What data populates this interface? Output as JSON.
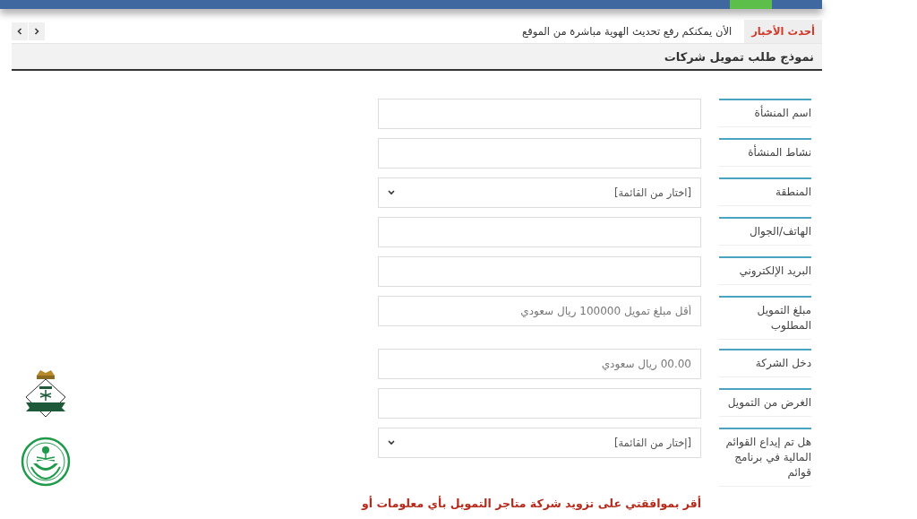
{
  "news": {
    "label": "أحدث الأخبار",
    "text": "الأن يمكنكم رفع تحديث الهوية مباشرة من الموقع"
  },
  "form": {
    "title": "نموذج طلب تمويل شركات",
    "fields": [
      {
        "label": "اسم المنشأة",
        "kind": "text"
      },
      {
        "label": "نشاط المنشأة",
        "kind": "text"
      },
      {
        "label": "المنطقة",
        "kind": "select",
        "value": "[اختار من القائمة]"
      },
      {
        "label": "الهاتف/الجوال",
        "kind": "text"
      },
      {
        "label": "البريد الإلكتروني",
        "kind": "text"
      },
      {
        "label": "مبلغ التمويل المطلوب",
        "kind": "text",
        "placeholder": "أقل مبلغ تمويل 100000 ريال سعودي"
      },
      {
        "label": "دخل الشركة",
        "kind": "text",
        "placeholder": "00.00 ريال سعودي"
      },
      {
        "label": "الغرض من التمويل",
        "kind": "text"
      },
      {
        "label": "هل تم إيداع القوائم المالية في برنامج قوائم",
        "kind": "select",
        "value": "[إختار من القائمة]"
      }
    ],
    "consent": "أقر بموافقتي على تزويد شركة متاجر التمويل بأي معلومات أو"
  }
}
